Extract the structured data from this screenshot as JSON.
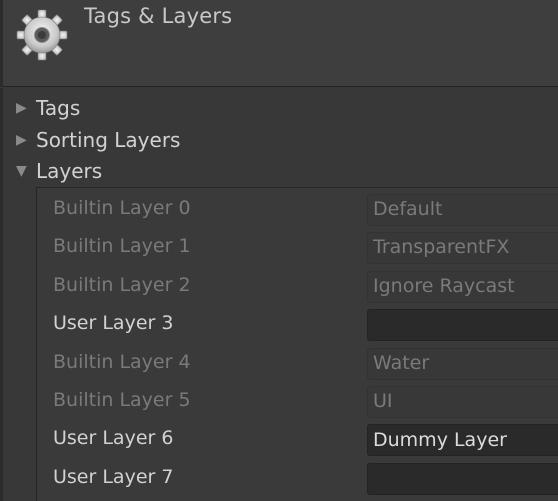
{
  "header": {
    "title": "Tags & Layers",
    "icon": "gear-icon"
  },
  "foldouts": [
    {
      "label": "Tags",
      "expanded": false
    },
    {
      "label": "Sorting Layers",
      "expanded": false
    },
    {
      "label": "Layers",
      "expanded": true
    }
  ],
  "layers": [
    {
      "label": "Builtin Layer 0",
      "value": "Default",
      "editable": false
    },
    {
      "label": "Builtin Layer 1",
      "value": "TransparentFX",
      "editable": false
    },
    {
      "label": "Builtin Layer 2",
      "value": "Ignore Raycast",
      "editable": false
    },
    {
      "label": "User Layer 3",
      "value": "",
      "editable": true
    },
    {
      "label": "Builtin Layer 4",
      "value": "Water",
      "editable": false
    },
    {
      "label": "Builtin Layer 5",
      "value": "UI",
      "editable": false
    },
    {
      "label": "User Layer 6",
      "value": "Dummy Layer",
      "editable": true
    },
    {
      "label": "User Layer 7",
      "value": "",
      "editable": true
    }
  ]
}
